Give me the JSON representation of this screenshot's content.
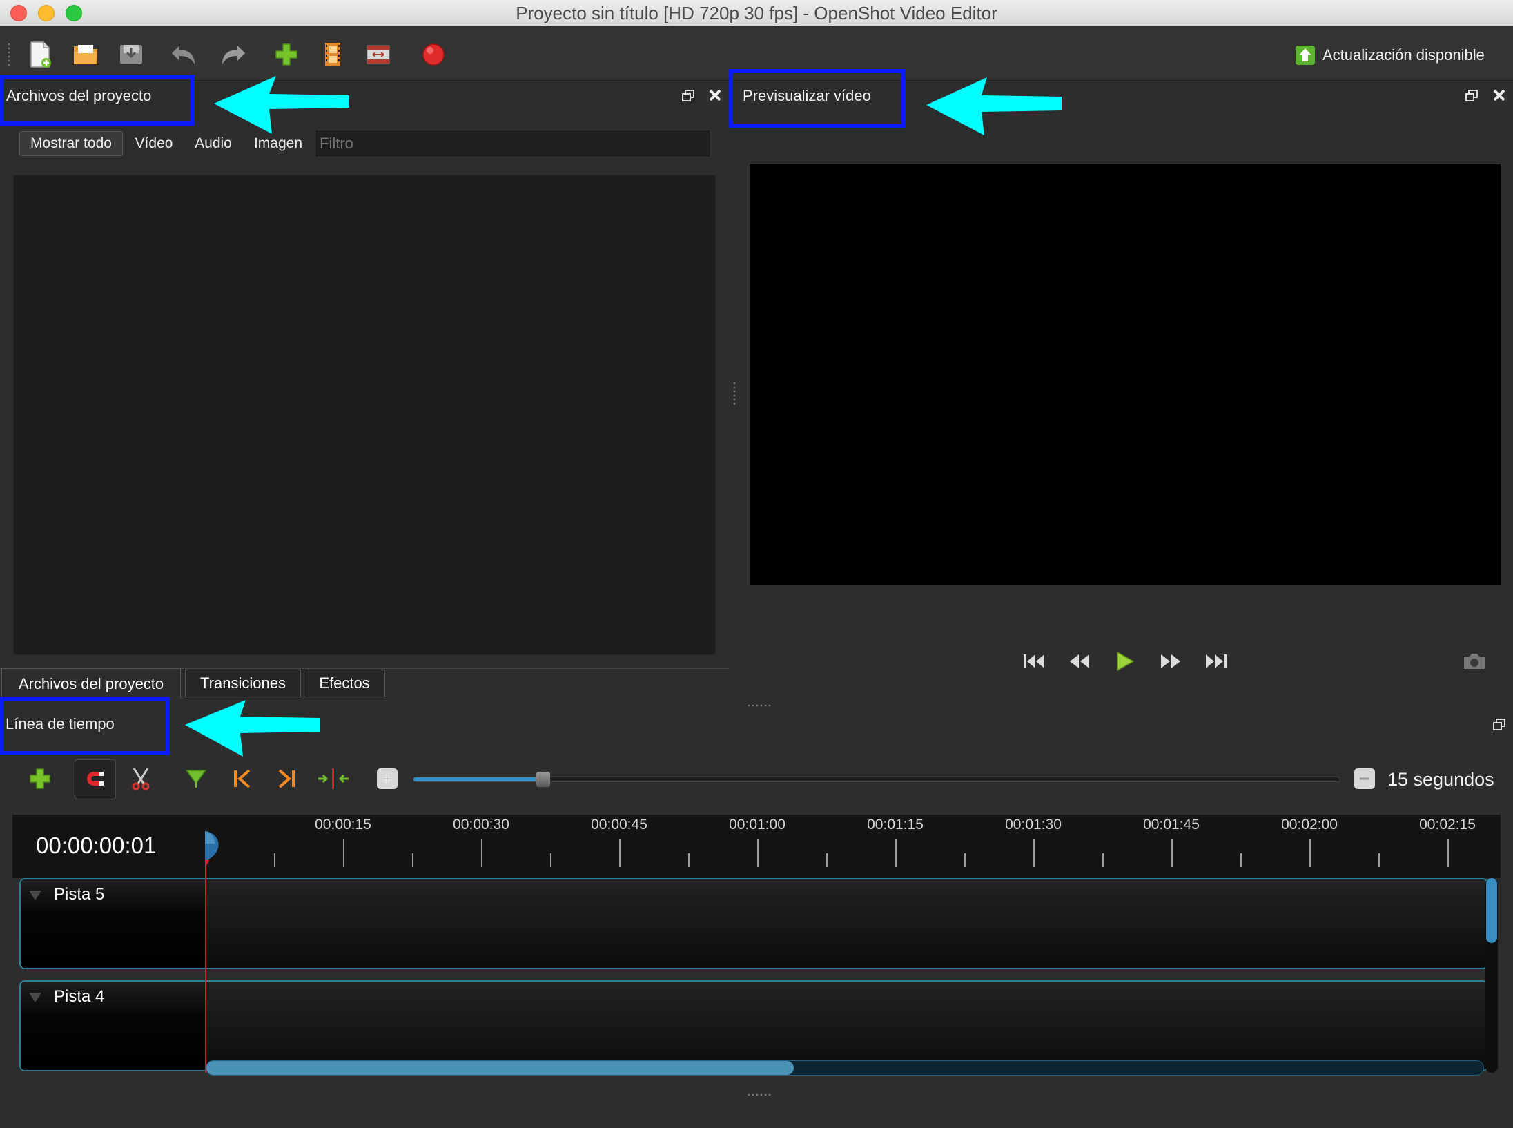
{
  "window": {
    "title": "Proyecto sin título [HD 720p 30 fps] - OpenShot Video Editor"
  },
  "toolbar": {
    "update_label": "Actualización disponible",
    "buttons": [
      "new-project",
      "open-project",
      "save-project",
      "undo",
      "redo",
      "import-files",
      "profile",
      "fullscreen",
      "export"
    ]
  },
  "project_files": {
    "title": "Archivos del proyecto",
    "filters": [
      "Mostrar todo",
      "Vídeo",
      "Audio",
      "Imagen"
    ],
    "filter_placeholder": "Filtro",
    "tabs": [
      "Archivos del proyecto",
      "Transiciones",
      "Efectos"
    ]
  },
  "preview": {
    "title": "Previsualizar vídeo",
    "controls": [
      "jump-start",
      "rewind",
      "play",
      "fast-forward",
      "jump-end",
      "snapshot"
    ]
  },
  "timeline": {
    "title": "Línea de tiempo",
    "zoom_label": "15 segundos",
    "zoom_level": 0.14,
    "current_time": "00:00:00:01",
    "ruler": [
      "00:00:15",
      "00:00:30",
      "00:00:45",
      "00:01:00",
      "00:01:15",
      "00:01:30",
      "00:01:45",
      "00:02:00",
      "00:02:15"
    ],
    "tracks": [
      "Pista 5",
      "Pista 4"
    ],
    "scroll_position": 0.46
  },
  "colors": {
    "annotation_box": "#0a1cff",
    "annotation_arrow": "#00ffff",
    "playhead": "#d81e2a",
    "accent": "#3a8fc2"
  }
}
